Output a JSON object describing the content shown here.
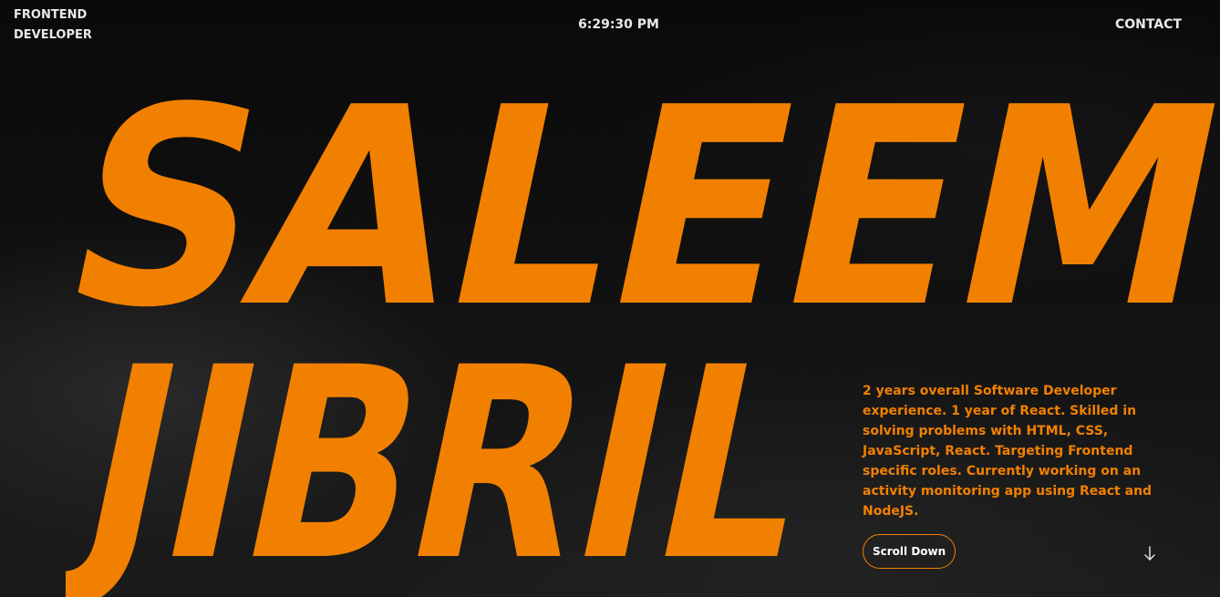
{
  "header": {
    "role_line1": "FRONTEND",
    "role_line2": "DEVELOPER",
    "clock": "6:29:30 PM",
    "contact_label": "CONTACT"
  },
  "hero": {
    "first_name": "SALEEM",
    "last_name": "JIBRIL"
  },
  "bio": {
    "text": "2 years overall Software Developer experience. 1 year of React. Skilled in solving problems with HTML, CSS, JavaScript, React. Targeting Frontend specific roles. Currently working on an activity monitoring app using React and NodeJS.",
    "scroll_label": "Scroll Down",
    "scroll_icon": "arrow-down-icon"
  },
  "colors": {
    "accent": "#f28000",
    "text": "#e9e9e9",
    "background": "#0d0d0d"
  }
}
